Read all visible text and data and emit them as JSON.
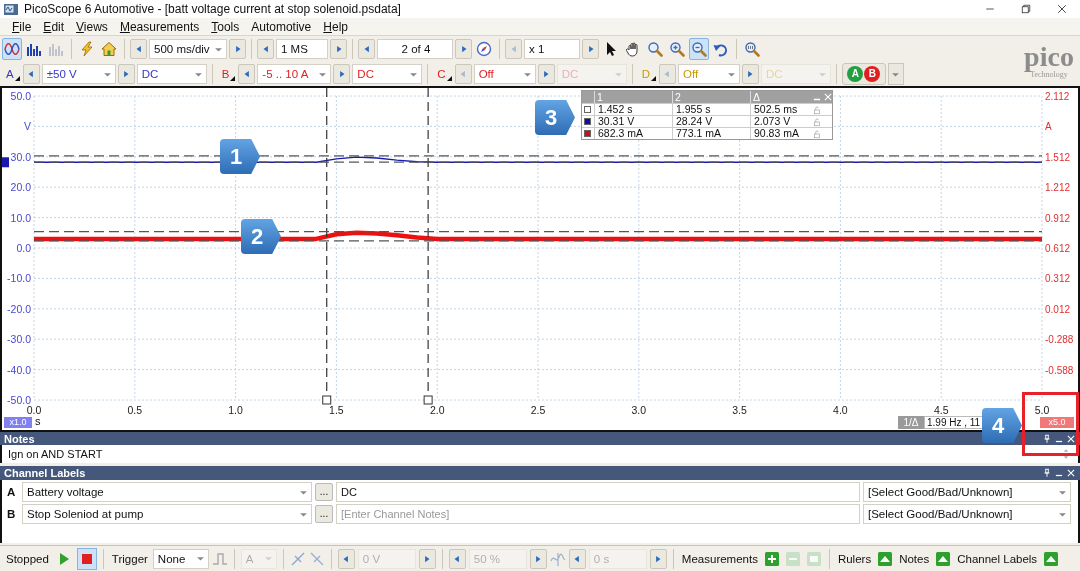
{
  "window": {
    "title": "PicoScope 6 Automotive - [batt voltage current at stop solenoid.psdata]"
  },
  "menu": [
    {
      "label": "File",
      "mnemonic": true
    },
    {
      "label": "Edit",
      "mnemonic": true
    },
    {
      "label": "Views",
      "mnemonic": true
    },
    {
      "label": "Measurements",
      "mnemonic": true
    },
    {
      "label": "Tools",
      "mnemonic": true
    },
    {
      "label": "Automotive",
      "mnemonic": false
    },
    {
      "label": "Help",
      "mnemonic": true
    }
  ],
  "toolbar": {
    "view_buttons": [
      {
        "kind": "scope",
        "selected": true,
        "disabled": false
      },
      {
        "kind": "spectrum",
        "selected": false,
        "disabled": false
      },
      {
        "kind": "persistence",
        "selected": false,
        "disabled": true
      },
      {
        "kind": "lightning",
        "selected": false,
        "disabled": false
      },
      {
        "kind": "home",
        "selected": false,
        "disabled": false
      }
    ],
    "timebase": "500 ms/div",
    "samples": "1 MS",
    "buffer": "2 of 4",
    "zoom_factor": "x 1",
    "tools": [
      {
        "kind": "pointer",
        "selected": false
      },
      {
        "kind": "hand",
        "selected": false
      },
      {
        "kind": "zoom-area",
        "selected": false
      },
      {
        "kind": "zoom-in",
        "selected": false
      },
      {
        "kind": "zoom-out",
        "selected": true
      },
      {
        "kind": "undo",
        "selected": false
      },
      {
        "kind": "zoom-fit",
        "selected": false
      }
    ]
  },
  "channels": [
    {
      "letter": "A",
      "range": "±50 V",
      "coupling": "DC",
      "color": "#3535c8",
      "enabled": true
    },
    {
      "letter": "B",
      "range": "-5 .. 10 A",
      "coupling": "DC",
      "color": "#e02020",
      "enabled": true
    },
    {
      "letter": "C",
      "range": "Off",
      "coupling": "DC",
      "color": "#e02020",
      "enabled": false
    },
    {
      "letter": "D",
      "range": "Off",
      "coupling": "DC",
      "color": "#c89a00",
      "enabled": false
    }
  ],
  "channel_toggle": [
    {
      "label": "A",
      "color": "#20a040"
    },
    {
      "label": "B",
      "color": "#e02020"
    }
  ],
  "logo": {
    "name": "pico",
    "tagline": "Technology"
  },
  "scope": {
    "chart_data": {
      "type": "line",
      "xlabel": "s",
      "ylabel": "V",
      "xlim": [
        0,
        5
      ],
      "ylim": [
        -50,
        50
      ],
      "x": [
        0,
        0.1,
        0.2,
        0.3,
        0.4,
        0.5,
        0.6,
        0.7,
        0.8,
        0.9,
        1.25,
        1.3,
        1.4,
        1.5,
        1.6,
        1.7,
        1.8,
        1.9,
        2,
        2.1,
        2.2,
        2.3,
        2.4,
        2.5,
        2.6,
        2.7,
        2.8,
        2.9,
        3,
        3.1,
        3.2,
        3.3,
        3.4,
        3.5,
        3.6,
        3.7,
        3.8,
        3.9,
        4,
        4.1,
        4.2,
        4.3,
        4.4,
        4.5,
        4.6,
        4.7,
        4.8,
        4.9,
        5
      ],
      "grid": true,
      "series": [
        {
          "color": "#1a1ab0",
          "values": [
            28.2,
            28.2,
            28.2,
            28.2,
            28.2,
            28.2,
            28.2,
            28.2,
            28.2,
            28.2,
            28.2,
            28.2,
            28.2,
            29.3,
            29.9,
            29.6,
            28.9,
            28.4,
            28.2,
            28.2,
            28.2,
            28.2,
            28.2,
            28.2,
            28.2,
            28.2,
            28.2,
            28.2,
            28.2,
            28.2,
            28.2,
            28.2,
            28.2,
            28.2,
            28.2,
            28.2,
            28.2,
            28.2,
            28.2,
            28.2,
            28.2,
            28.2,
            28.2,
            28.2,
            28.2,
            28.2,
            28.2,
            28.2,
            28.2
          ]
        },
        {
          "color": "#ee1010",
          "values": [
            3,
            3,
            3,
            3,
            3,
            3,
            3,
            3,
            3,
            3,
            3,
            3,
            3,
            4.5,
            5,
            4.8,
            4.2,
            3.5,
            3,
            3,
            3,
            3,
            3,
            3,
            3,
            3,
            3,
            3,
            3,
            3,
            3,
            3,
            3,
            3,
            3,
            3,
            3,
            3,
            3,
            3,
            3,
            3,
            3,
            3,
            3,
            3,
            3,
            3,
            3
          ]
        }
      ],
      "xticks": [
        {
          "value": 0,
          "label": "0.0"
        },
        {
          "value": 0.5,
          "label": "0.5"
        },
        {
          "value": 1,
          "label": "1.0"
        },
        {
          "value": 1.5,
          "label": "1.5"
        },
        {
          "value": 2,
          "label": "2.0"
        },
        {
          "value": 2.5,
          "label": "2.5"
        },
        {
          "value": 3,
          "label": "3.0"
        },
        {
          "value": 3.5,
          "label": "3.5"
        },
        {
          "value": 4,
          "label": "4.0"
        },
        {
          "value": 4.5,
          "label": "4.5"
        },
        {
          "value": 5,
          "label": "5.0"
        }
      ],
      "yticks": [
        {
          "value": 50,
          "label": "50.0"
        },
        {
          "value": 30,
          "label": "30.0"
        },
        {
          "value": 20,
          "label": "20.0"
        },
        {
          "value": 10,
          "label": "10.0"
        },
        {
          "value": 0,
          "label": "0.0"
        },
        {
          "value": -10,
          "label": "-10.0"
        },
        {
          "value": -20,
          "label": "-20.0"
        },
        {
          "value": -30,
          "label": "-30.0"
        },
        {
          "value": -40,
          "label": "-40.0"
        },
        {
          "value": -50,
          "label": "-50.0"
        }
      ],
      "ref_lines": [
        {
          "axis": "x",
          "value": 1.452
        },
        {
          "axis": "x",
          "value": 1.955
        },
        {
          "axis": "y",
          "value": 30.31
        },
        {
          "axis": "y",
          "value": 28.24
        },
        {
          "axis": "y",
          "value": 5.37
        },
        {
          "axis": "y",
          "value": 2.34
        }
      ]
    },
    "right_axis": {
      "unit": "A",
      "ticks": [
        "2.112",
        "1.512",
        "1.212",
        "0.912",
        "0.612",
        "0.312",
        "0.012",
        "-0.288",
        "-0.588"
      ]
    },
    "ruler_table": {
      "columns": [
        "1",
        "2",
        "Δ"
      ],
      "rows": [
        {
          "color": "#ffffff",
          "cells": [
            "1.452 s",
            "1.955 s",
            "502.5 ms"
          ]
        },
        {
          "color": "#1010a0",
          "cells": [
            "30.31 V",
            "28.24 V",
            "2.073 V"
          ]
        },
        {
          "color": "#d01010",
          "cells": [
            "682.3 mA",
            "773.1 mA",
            "90.83 mA"
          ]
        }
      ]
    },
    "time_scale_badge": "x1.0",
    "channel_scale_badge": "x5.0",
    "frequency_label": "1/Δ",
    "frequency_value": "1.99 Hz , 11"
  },
  "callouts": [
    {
      "label": "1"
    },
    {
      "label": "2"
    },
    {
      "label": "3"
    },
    {
      "label": "4"
    }
  ],
  "notes": {
    "title": "Notes",
    "text": "Ign on AND START"
  },
  "channel_labels": {
    "title": "Channel Labels",
    "rows": [
      {
        "letter": "A",
        "label": "Battery voltage",
        "browse_button": "...",
        "notes": "DC",
        "status": "[Select Good/Bad/Unknown]"
      },
      {
        "letter": "B",
        "label": "Stop Soleniod at pump",
        "browse_button": "...",
        "placeholder": "[Enter Channel Notes]",
        "status": "[Select Good/Bad/Unknown]"
      }
    ]
  },
  "status_bar": {
    "state": "Stopped",
    "run_buttons": [
      {
        "kind": "play",
        "selected": false
      },
      {
        "kind": "stop",
        "selected": true
      }
    ],
    "trigger_label": "Trigger",
    "trigger_mode": "None",
    "trigger_channel": {
      "value": "A",
      "disabled": true
    },
    "threshold": {
      "value": "0 V",
      "disabled": true
    },
    "pre_trigger": {
      "value": "50 %",
      "disabled": true
    },
    "delay": {
      "value": "0 s",
      "disabled": true
    },
    "measurements_label": "Measurements",
    "measurement_buttons": [
      {
        "kind": "add",
        "disabled": false
      },
      {
        "kind": "edit",
        "disabled": true
      },
      {
        "kind": "delete",
        "disabled": true
      }
    ],
    "panel_toggles": [
      {
        "label": "Rulers"
      },
      {
        "label": "Notes"
      },
      {
        "label": "Channel Labels"
      }
    ]
  }
}
